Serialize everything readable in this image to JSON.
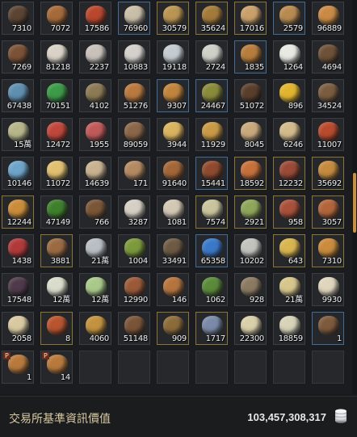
{
  "inventory": {
    "rows": [
      [
        {
          "qty": "7310",
          "icon": "seeds-icon",
          "color": "#5b4433",
          "frame": "n"
        },
        {
          "qty": "7072",
          "icon": "onion-icon",
          "color": "#a56a3a",
          "frame": "n"
        },
        {
          "qty": "17586",
          "icon": "chili-pepper-icon",
          "color": "#b8472e",
          "frame": "n"
        },
        {
          "qty": "76960",
          "icon": "garlic-icon",
          "color": "#c9bfa8",
          "frame": "b"
        },
        {
          "qty": "30579",
          "icon": "stew-dish-icon",
          "color": "#b99452",
          "frame": "g"
        },
        {
          "qty": "35624",
          "icon": "soup-bowl-icon",
          "color": "#a47a3a",
          "frame": "g"
        },
        {
          "qty": "17016",
          "icon": "pasta-dish-icon",
          "color": "#c9a06a",
          "frame": "g"
        },
        {
          "qty": "2579",
          "icon": "meal-plate-icon",
          "color": "#b88a50",
          "frame": "b"
        },
        {
          "qty": "96889",
          "icon": "grain-bowl-icon",
          "color": "#c98a45",
          "frame": "n"
        }
      ],
      [
        {
          "qty": "7269",
          "icon": "barrel-icon",
          "color": "#7b5236",
          "frame": "n"
        },
        {
          "qty": "81218",
          "icon": "flour-bowl-icon",
          "color": "#d9d2c6",
          "frame": "n"
        },
        {
          "qty": "2237",
          "icon": "salt-pile-icon",
          "color": "#c8c2bb",
          "frame": "n"
        },
        {
          "qty": "10883",
          "icon": "sugar-pile-icon",
          "color": "#d4d0cb",
          "frame": "n"
        },
        {
          "qty": "19118",
          "icon": "cocktail-glass-icon",
          "color": "#c4ccd1",
          "frame": "n"
        },
        {
          "qty": "2724",
          "icon": "wine-glass-icon",
          "color": "#cfd0c8",
          "frame": "n"
        },
        {
          "qty": "1835",
          "icon": "noodle-bowl-icon",
          "color": "#b67d3c",
          "frame": "b"
        },
        {
          "qty": "1264",
          "icon": "milk-bottle-icon",
          "color": "#e9e9e3",
          "frame": "n"
        },
        {
          "qty": "4694",
          "icon": "branch-icon",
          "color": "#6d5138",
          "frame": "n"
        }
      ],
      [
        {
          "qty": "67438",
          "icon": "water-flask-icon",
          "color": "#5f8fb0",
          "frame": "n"
        },
        {
          "qty": "70151",
          "icon": "green-leaf-icon",
          "color": "#3c9a48",
          "frame": "n"
        },
        {
          "qty": "4102",
          "icon": "seed-pod-icon",
          "color": "#8c7a55",
          "frame": "n"
        },
        {
          "qty": "51276",
          "icon": "onion-icon",
          "color": "#b9793f",
          "frame": "n"
        },
        {
          "qty": "9307",
          "icon": "curry-dish-icon",
          "color": "#c0843c",
          "frame": "b"
        },
        {
          "qty": "24467",
          "icon": "salad-dish-icon",
          "color": "#8a8a3b",
          "frame": "b"
        },
        {
          "qty": "51072",
          "icon": "bean-pile-icon",
          "color": "#5a3e2c",
          "frame": "n"
        },
        {
          "qty": "896",
          "icon": "sunflower-icon",
          "color": "#e1b52e",
          "frame": "n"
        },
        {
          "qty": "34524",
          "icon": "root-icon",
          "color": "#7a5d40",
          "frame": "n"
        }
      ],
      [
        {
          "qty": "15萬",
          "icon": "scroll-icon",
          "color": "#b7b68a",
          "frame": "n"
        },
        {
          "qty": "12472",
          "icon": "jam-jar-icon",
          "color": "#c0473b",
          "frame": "n"
        },
        {
          "qty": "1955",
          "icon": "jam-jar-icon",
          "color": "#c05a5a",
          "frame": "n"
        },
        {
          "qty": "89059",
          "icon": "mortar-icon",
          "color": "#8b6648",
          "frame": "n"
        },
        {
          "qty": "3944",
          "icon": "cheese-icon",
          "color": "#d9b35e",
          "frame": "n"
        },
        {
          "qty": "11929",
          "icon": "wheat-icon",
          "color": "#c99a45",
          "frame": "n"
        },
        {
          "qty": "8045",
          "icon": "bread-bowl-icon",
          "color": "#c9a97c",
          "frame": "n"
        },
        {
          "qty": "6246",
          "icon": "porridge-bowl-icon",
          "color": "#d2ba8a",
          "frame": "n"
        },
        {
          "qty": "11007",
          "icon": "red-soup-icon",
          "color": "#b84a2e",
          "frame": "n"
        }
      ],
      [
        {
          "qty": "10146",
          "icon": "crystal-icon",
          "color": "#6ea4c9",
          "frame": "n"
        },
        {
          "qty": "11072",
          "icon": "cheese-wedge-icon",
          "color": "#e0c070",
          "frame": "n"
        },
        {
          "qty": "14639",
          "icon": "dumpling-plate-icon",
          "color": "#c8b290",
          "frame": "n"
        },
        {
          "qty": "171",
          "icon": "fish-plate-icon",
          "color": "#b48a62",
          "frame": "n"
        },
        {
          "qty": "91640",
          "icon": "bread-loaf-icon",
          "color": "#a26638",
          "frame": "n"
        },
        {
          "qty": "15441",
          "icon": "steak-plate-icon",
          "color": "#8f4a2e",
          "frame": "b"
        },
        {
          "qty": "18592",
          "icon": "breakfast-plate-icon",
          "color": "#c6703a",
          "frame": "g"
        },
        {
          "qty": "12232",
          "icon": "sausage-plate-icon",
          "color": "#9a4a36",
          "frame": "g"
        },
        {
          "qty": "35692",
          "icon": "feast-platter-icon",
          "color": "#c48a3e",
          "frame": "g"
        }
      ],
      [
        {
          "qty": "12244",
          "icon": "curry-bowl-icon",
          "color": "#c98c3a",
          "frame": "g"
        },
        {
          "qty": "47149",
          "icon": "green-pepper-icon",
          "color": "#3e7f2c",
          "frame": "n"
        },
        {
          "qty": "766",
          "icon": "coconut-icon",
          "color": "#7a5536",
          "frame": "n"
        },
        {
          "qty": "3287",
          "icon": "sushi-icon",
          "color": "#d6d0c4",
          "frame": "n"
        },
        {
          "qty": "1081",
          "icon": "rice-cake-icon",
          "color": "#d3c7b5",
          "frame": "n"
        },
        {
          "qty": "7574",
          "icon": "tea-cup-icon",
          "color": "#c9c49d",
          "frame": "g"
        },
        {
          "qty": "2921",
          "icon": "veggie-plate-icon",
          "color": "#8fa65a",
          "frame": "g"
        },
        {
          "qty": "958",
          "icon": "meat-plate-icon",
          "color": "#a8503a",
          "frame": "g"
        },
        {
          "qty": "3057",
          "icon": "grilled-plate-icon",
          "color": "#b2653b",
          "frame": "g"
        }
      ],
      [
        {
          "qty": "1438",
          "icon": "raw-meat-icon",
          "color": "#b03a3a",
          "frame": "n"
        },
        {
          "qty": "3881",
          "icon": "platter-icon",
          "color": "#9b6a42",
          "frame": "g"
        },
        {
          "qty": "21萬",
          "icon": "fish-icon",
          "color": "#b9bec4",
          "frame": "n"
        },
        {
          "qty": "1004",
          "icon": "salad-bowl-icon",
          "color": "#7c9a3c",
          "frame": "n"
        },
        {
          "qty": "33491",
          "icon": "wrench-icon",
          "color": "#6d5a44",
          "frame": "n"
        },
        {
          "qty": "65358",
          "icon": "blue-flower-icon",
          "color": "#3a78c8",
          "frame": "b"
        },
        {
          "qty": "10202",
          "icon": "salt-mound-icon",
          "color": "#c2c2be",
          "frame": "n"
        },
        {
          "qty": "643",
          "icon": "omelet-plate-icon",
          "color": "#d8b54e",
          "frame": "g"
        },
        {
          "qty": "7310",
          "icon": "feast-platter-icon",
          "color": "#c98b3c",
          "frame": "g"
        }
      ],
      [
        {
          "qty": "17548",
          "icon": "grapes-icon",
          "color": "#4e3a4a",
          "frame": "n"
        },
        {
          "qty": "12萬",
          "icon": "radish-icon",
          "color": "#d9dccb",
          "frame": "n"
        },
        {
          "qty": "12萬",
          "icon": "cabbage-icon",
          "color": "#a9c98a",
          "frame": "n"
        },
        {
          "qty": "12990",
          "icon": "roast-chicken-icon",
          "color": "#9a5a38",
          "frame": "n"
        },
        {
          "qty": "146",
          "icon": "treasure-box-icon",
          "color": "#b4743e",
          "frame": "n"
        },
        {
          "qty": "1062",
          "icon": "herb-icon",
          "color": "#5b8a3a",
          "frame": "n"
        },
        {
          "qty": "928",
          "icon": "canister-icon",
          "color": "#8a7a62",
          "frame": "n"
        },
        {
          "qty": "21萬",
          "icon": "parchment-icon",
          "color": "#d6c68c",
          "frame": "n"
        },
        {
          "qty": "9930",
          "icon": "rice-bowl-icon",
          "color": "#e0d6be",
          "frame": "n"
        }
      ],
      [
        {
          "qty": "2058",
          "icon": "grain-basket-icon",
          "color": "#d8c9a0",
          "frame": "n"
        },
        {
          "qty": "8",
          "icon": "hotpot-icon",
          "color": "#b8542e",
          "frame": "g"
        },
        {
          "qty": "4060",
          "icon": "gravy-bowl-icon",
          "color": "#c2923e",
          "frame": "n"
        },
        {
          "qty": "51148",
          "icon": "leather-icon",
          "color": "#7a5438",
          "frame": "n"
        },
        {
          "qty": "909",
          "icon": "fruit-basket-icon",
          "color": "#8b6b3a",
          "frame": "g"
        },
        {
          "qty": "1717",
          "icon": "gem-chest-icon",
          "color": "#7a8aa8",
          "frame": "g"
        },
        {
          "qty": "22300",
          "icon": "paper-roll-icon",
          "color": "#d9cfa8",
          "frame": "n"
        },
        {
          "qty": "18859",
          "icon": "cloth-sheet-icon",
          "color": "#d6d3b8",
          "frame": "n"
        },
        {
          "qty": "1",
          "icon": "chest-icon",
          "color": "#7d5a3c",
          "frame": "b"
        }
      ],
      [
        {
          "qty": "1",
          "icon": "gift-box-icon",
          "color": "#b87a3c",
          "frame": "n",
          "badge": "P"
        },
        {
          "qty": "14",
          "icon": "gift-box-icon",
          "color": "#b87a3c",
          "frame": "n",
          "badge": "P"
        },
        {
          "qty": "",
          "icon": "",
          "color": "",
          "frame": "e"
        },
        {
          "qty": "",
          "icon": "",
          "color": "",
          "frame": "e"
        },
        {
          "qty": "",
          "icon": "",
          "color": "",
          "frame": "e"
        },
        {
          "qty": "",
          "icon": "",
          "color": "",
          "frame": "e"
        },
        {
          "qty": "",
          "icon": "",
          "color": "",
          "frame": "e"
        },
        {
          "qty": "",
          "icon": "",
          "color": "",
          "frame": "e"
        },
        {
          "qty": "",
          "icon": "",
          "color": "",
          "frame": "e"
        }
      ]
    ]
  },
  "footer": {
    "label": "交易所基準資訊價值",
    "value": "103,457,308,317",
    "currency_icon": "silver-coins-icon"
  }
}
